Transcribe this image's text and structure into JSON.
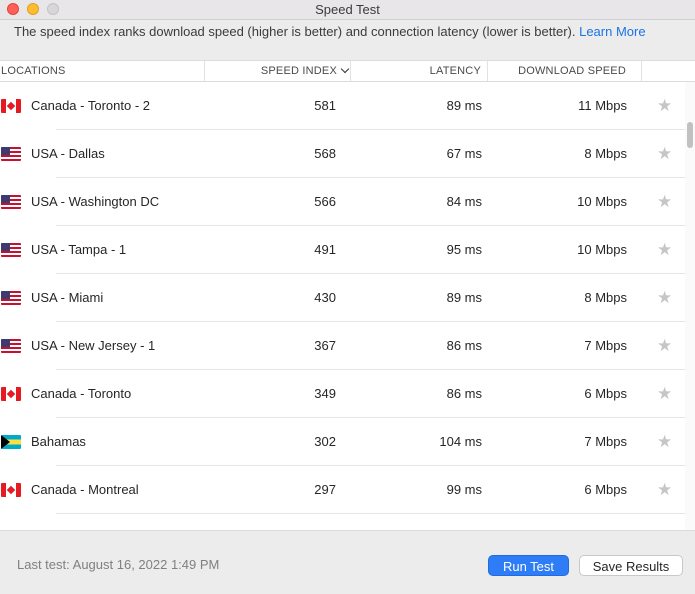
{
  "window": {
    "title": "Speed Test"
  },
  "info": {
    "text": "The speed index ranks download speed (higher is better) and connection latency (lower is better). ",
    "link": "Learn More"
  },
  "columns": {
    "locations": "LOCATIONS",
    "speed_index": "SPEED INDEX",
    "latency": "LATENCY",
    "download_speed": "DOWNLOAD SPEED"
  },
  "rows": [
    {
      "flag": "canada-flag",
      "location": "Canada - Toronto - 2",
      "speed_index": "581",
      "latency": "89 ms",
      "download": "11 Mbps"
    },
    {
      "flag": "usa-flag",
      "location": "USA - Dallas",
      "speed_index": "568",
      "latency": "67 ms",
      "download": "8 Mbps"
    },
    {
      "flag": "usa-flag",
      "location": "USA - Washington DC",
      "speed_index": "566",
      "latency": "84 ms",
      "download": "10 Mbps"
    },
    {
      "flag": "usa-flag",
      "location": "USA - Tampa - 1",
      "speed_index": "491",
      "latency": "95 ms",
      "download": "10 Mbps"
    },
    {
      "flag": "usa-flag",
      "location": "USA - Miami",
      "speed_index": "430",
      "latency": "89 ms",
      "download": "8 Mbps"
    },
    {
      "flag": "usa-flag",
      "location": "USA - New Jersey - 1",
      "speed_index": "367",
      "latency": "86 ms",
      "download": "7 Mbps"
    },
    {
      "flag": "canada-flag",
      "location": "Canada - Toronto",
      "speed_index": "349",
      "latency": "86 ms",
      "download": "6 Mbps"
    },
    {
      "flag": "bahamas-flag",
      "location": "Bahamas",
      "speed_index": "302",
      "latency": "104 ms",
      "download": "7 Mbps"
    },
    {
      "flag": "canada-flag",
      "location": "Canada - Montreal",
      "speed_index": "297",
      "latency": "99 ms",
      "download": "6 Mbps"
    }
  ],
  "footer": {
    "last_test": "Last test: August 16, 2022 1:49 PM",
    "run_test": "Run Test",
    "save_results": "Save Results"
  },
  "icons": {
    "star": "star-icon",
    "sort": "chevron-down-icon"
  },
  "colors": {
    "accent": "#2e7cf6",
    "link": "#1a73e8"
  }
}
